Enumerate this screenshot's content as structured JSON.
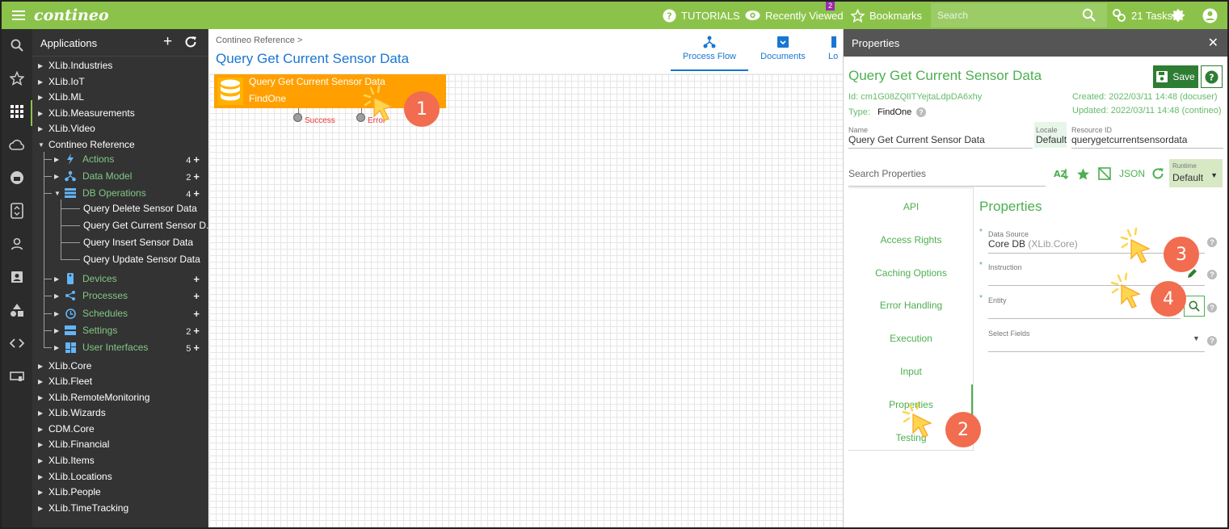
{
  "topbar": {
    "logo": "contineo",
    "tutorials": "TUTORIALS",
    "recently_viewed": "Recently Viewed",
    "recently_viewed_badge": "2",
    "bookmarks": "Bookmarks",
    "search_placeholder": "Search",
    "tasks": "21 Tasks"
  },
  "tree": {
    "title": "Applications",
    "top_items": [
      "XLib.Industries",
      "XLib.IoT",
      "XLib.ML",
      "XLib.Measurements",
      "XLib.Video"
    ],
    "expanded": "Contineo Reference",
    "sub_items": [
      {
        "label": "Actions",
        "count": "4"
      },
      {
        "label": "Data Model",
        "count": "2"
      },
      {
        "label": "DB Operations",
        "count": "4"
      }
    ],
    "leaves": [
      "Query Delete Sensor Data",
      "Query Get Current Sensor D...",
      "Query Insert Sensor Data",
      "Query Update Sensor Data"
    ],
    "sub_items_2": [
      {
        "label": "Devices",
        "count": ""
      },
      {
        "label": "Processes",
        "count": ""
      },
      {
        "label": "Schedules",
        "count": ""
      },
      {
        "label": "Settings",
        "count": "2"
      },
      {
        "label": "User Interfaces",
        "count": "5"
      }
    ],
    "bottom_items": [
      "XLib.Core",
      "XLib.Fleet",
      "XLib.RemoteMonitoring",
      "XLib.Wizards",
      "CDM.Core",
      "XLib.Financial",
      "XLib.Items",
      "XLib.Locations",
      "XLib.People",
      "XLib.TimeTracking"
    ]
  },
  "main": {
    "breadcrumb": "Contineo Reference >",
    "title": "Query Get Current Sensor Data",
    "tabs": [
      "Process Flow",
      "Documents",
      "Lo"
    ],
    "node": {
      "title": "Query Get Current Sensor Data",
      "subtitle": "FindOne",
      "port_success": "Success",
      "port_error": "Error"
    }
  },
  "props": {
    "header": "Properties",
    "title": "Query Get Current Sensor Data",
    "save": "Save",
    "id_label": "Id:",
    "id_value": "cm1G08ZQlITYejtaLdpDA6xhy",
    "type_label": "Type:",
    "type_value": "FindOne",
    "created": "Created: 2022/03/11 14:48 (docuser)",
    "updated": "Updated: 2022/03/11 14:48 (contineo)",
    "name_label": "Name",
    "name_value": "Query Get Current Sensor Data",
    "locale_label": "Locale",
    "locale_value": "Default",
    "resource_label": "Resource ID",
    "resource_value": "querygetcurrentsensordata",
    "search_placeholder": "Search Properties",
    "json": "JSON",
    "runtime_label": "Runtime",
    "runtime_value": "Default",
    "tabs": [
      "API",
      "Access Rights",
      "Caching Options",
      "Error Handling",
      "Execution",
      "Input",
      "Properties",
      "Testing"
    ],
    "section_title": "Properties",
    "fields": {
      "data_source_label": "Data Source",
      "data_source_value": "Core DB",
      "data_source_hint": "(XLib.Core)",
      "instruction_label": "Instruction",
      "entity_label": "Entity",
      "select_fields_label": "Select Fields"
    }
  },
  "annotations": [
    "1",
    "2",
    "3",
    "4"
  ],
  "colors": {
    "accent": "#8bc34a",
    "link_blue": "#1976d2",
    "node_orange": "#ffa000",
    "step_marker": "#f26c4f",
    "save_green": "#2e7d32"
  }
}
